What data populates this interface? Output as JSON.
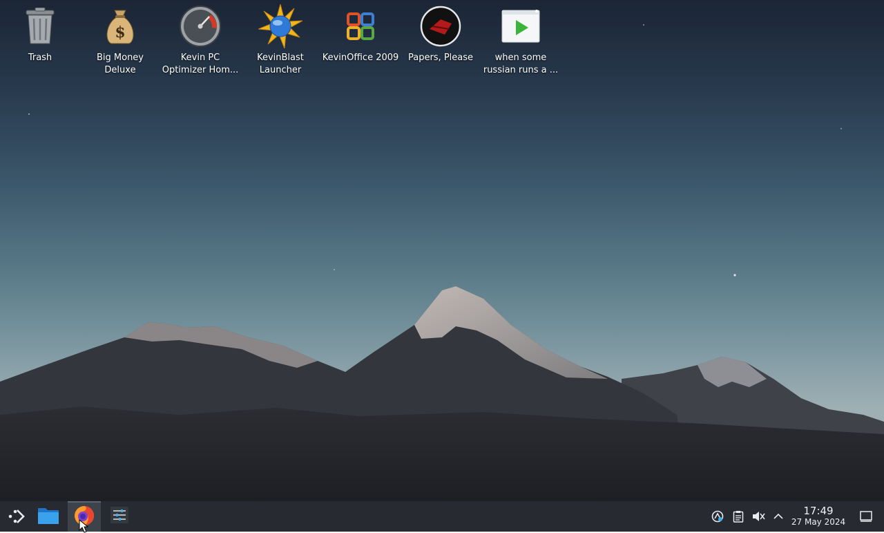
{
  "desktop": {
    "icons": [
      {
        "label": "Trash",
        "icon": "trash-icon"
      },
      {
        "label": "Big Money\nDeluxe",
        "icon": "money-bag-icon"
      },
      {
        "label": "Kevin PC\nOptimizer Hom...",
        "icon": "speedometer-icon"
      },
      {
        "label": "KevinBlast\nLauncher",
        "icon": "starburst-globe-icon"
      },
      {
        "label": "KevinOffice 2009",
        "icon": "office-logo-icon"
      },
      {
        "label": "Papers, Please",
        "icon": "papers-please-icon"
      },
      {
        "label": "when some\nrussian runs a ...",
        "icon": "video-file-icon"
      }
    ]
  },
  "taskbar": {
    "launcher": "application-launcher-icon",
    "tasks": [
      {
        "name": "file-manager",
        "icon": "folder-icon"
      },
      {
        "name": "firefox",
        "icon": "firefox-icon",
        "active": true
      },
      {
        "name": "settings",
        "icon": "sliders-icon"
      }
    ],
    "tray": [
      "network-icon",
      "clipboard-icon",
      "volume-muted-icon",
      "chevron-up-icon"
    ],
    "clock": {
      "time": "17:49",
      "date": "27 May 2024"
    },
    "show_desktop": "show-desktop-icon"
  },
  "colors": {
    "taskbar": "#272b31",
    "label_text": "#ffffff",
    "sky_top": "#1b2535",
    "sky_bottom": "#9fb0b4"
  }
}
